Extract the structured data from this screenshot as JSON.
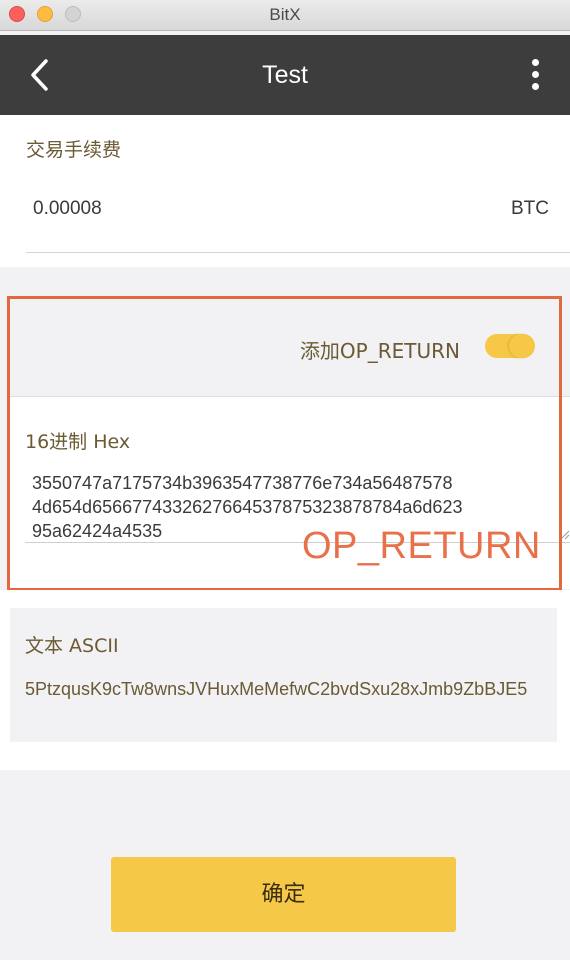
{
  "window": {
    "title": "BitX"
  },
  "header": {
    "title": "Test",
    "back_icon": "chevron-left-icon",
    "menu_icon": "more-vertical-icon"
  },
  "fee": {
    "label": "交易手续费",
    "value": "0.00008",
    "unit": "BTC"
  },
  "op_return": {
    "toggle_label": "添加OP_RETURN",
    "toggle_on": true,
    "hex_label": "16进制 Hex",
    "hex_lines": [
      "3550747a7175734b3963547738776e734a56487578",
      "4d654d6566774332627664537875323878784a6d623",
      "95a62424a4535"
    ],
    "annotation": "OP_RETURN"
  },
  "ascii": {
    "label": "文本 ASCII",
    "value": "5PtzqusK9cTw8wnsJVHuxMeMefwC2bvdSxu28xJmb9ZbBJE5"
  },
  "actions": {
    "confirm_label": "确定"
  },
  "colors": {
    "accent": "#f6c847",
    "header_bg": "#3d3d3d",
    "annotation": "#e2683f",
    "label_text": "#6b5a34"
  }
}
